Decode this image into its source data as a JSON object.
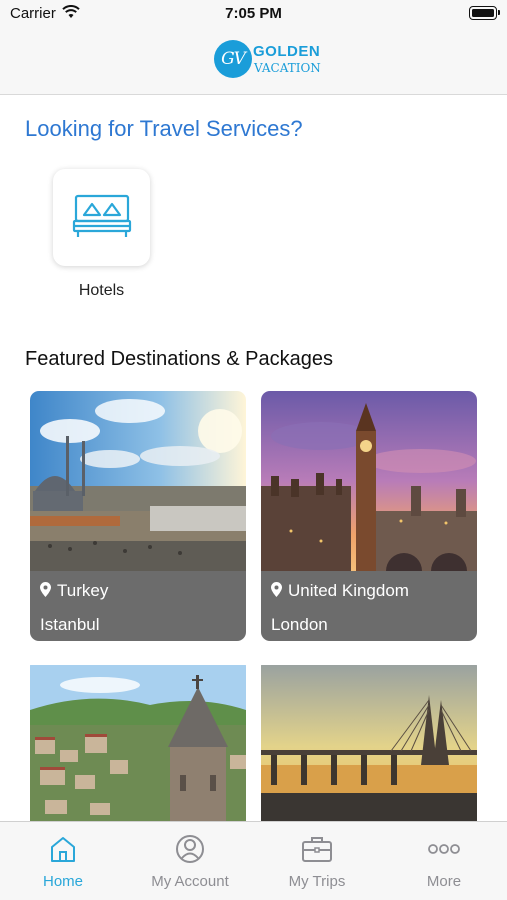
{
  "status_bar": {
    "carrier": "Carrier",
    "time": "7:05 PM"
  },
  "header": {
    "logo_badge": "GV",
    "logo_word1": "GOLDEN",
    "logo_word2": "VACATION"
  },
  "services": {
    "title": "Looking for Travel Services?",
    "items": [
      {
        "label": "Hotels",
        "icon": "bed-icon"
      }
    ]
  },
  "featured": {
    "title": "Featured Destinations & Packages",
    "cards": [
      {
        "country": "Turkey",
        "city": "Istanbul"
      },
      {
        "country": "United Kingdom",
        "city": "London"
      },
      {
        "country": "",
        "city": ""
      },
      {
        "country": "",
        "city": ""
      }
    ]
  },
  "tabs": [
    {
      "label": "Home",
      "icon": "home-icon",
      "active": true
    },
    {
      "label": "My Account",
      "icon": "account-icon",
      "active": false
    },
    {
      "label": "My Trips",
      "icon": "briefcase-icon",
      "active": false
    },
    {
      "label": "More",
      "icon": "more-icon",
      "active": false
    }
  ],
  "colors": {
    "accent": "#2aa7d9",
    "title_blue": "#2e78d2",
    "card_info_bg": "#6c6c6c"
  }
}
